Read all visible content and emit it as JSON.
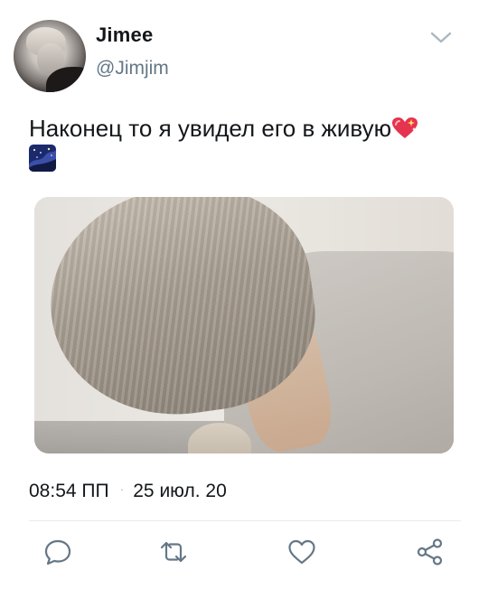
{
  "user": {
    "display_name": "Jimee",
    "handle": "@Jimjim"
  },
  "tweet": {
    "text": "Наконец то я увидел его в живую",
    "emoji": [
      "sparkling-heart",
      "night-with-stars"
    ],
    "time": "08:54 ПП",
    "separator": "·",
    "date": "25 июл. 20"
  },
  "actions": [
    "reply-icon",
    "retweet-icon",
    "like-icon",
    "share-icon"
  ],
  "colors": {
    "text": "#14171a",
    "secondary": "#657786",
    "icon": "#657786",
    "divider": "#e6ecf0"
  }
}
